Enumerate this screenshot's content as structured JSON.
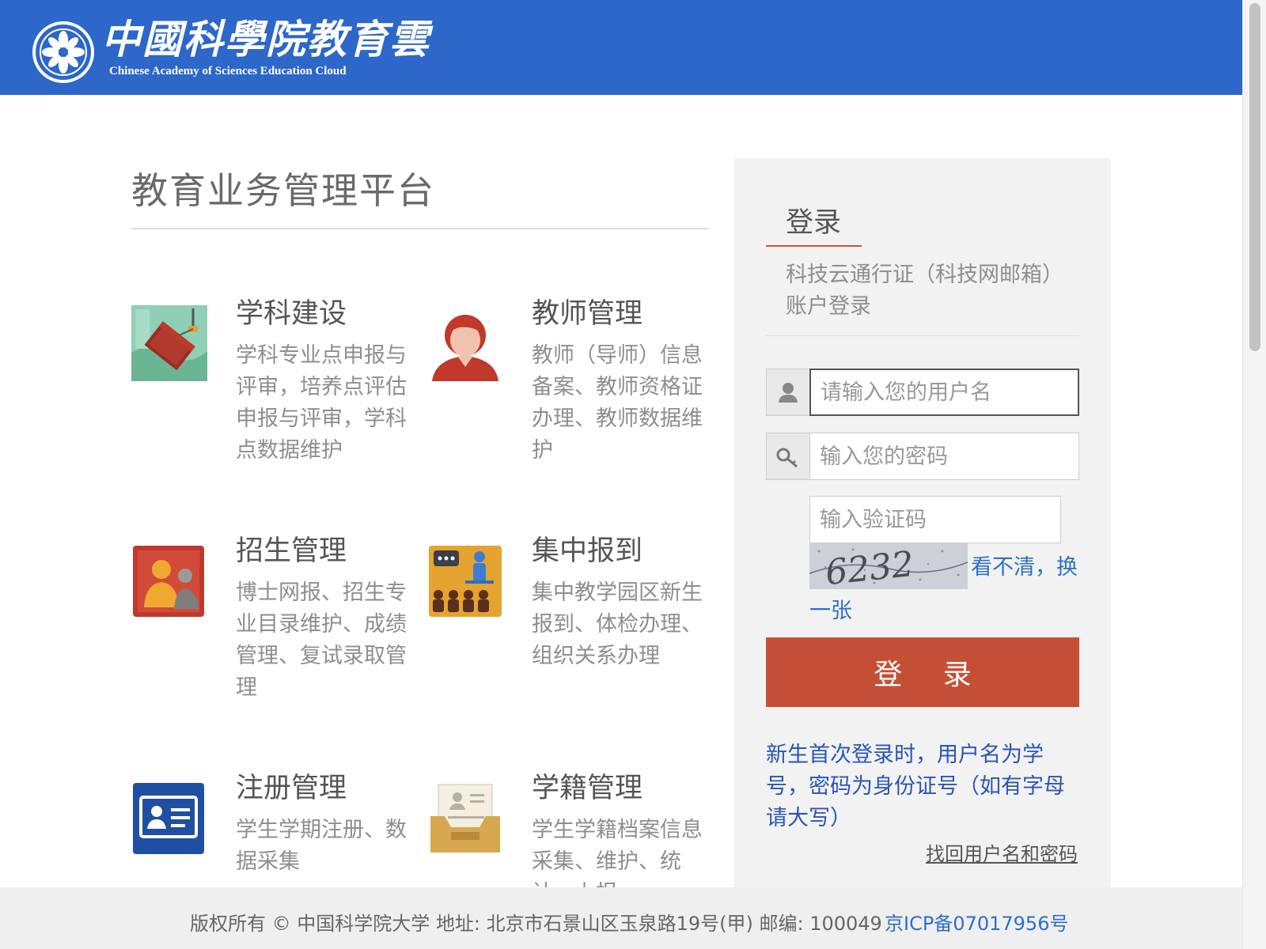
{
  "header": {
    "logo_cn": "中國科學院教育雲",
    "logo_en": "Chinese Academy of Sciences Education Cloud",
    "logo_icon": "cas-emblem-icon",
    "bg_color": "#2c67c9"
  },
  "main": {
    "title": "教育业务管理平台",
    "modules": [
      {
        "title": "学科建设",
        "desc": "学科专业点申报与评审，培养点评估申报与评审，学科点数据维护",
        "icon": "book-crane-icon"
      },
      {
        "title": "教师管理",
        "desc": "教师（导师）信息备案、教师资格证办理、教师数据维护",
        "icon": "teacher-avatar-icon"
      },
      {
        "title": "招生管理",
        "desc": "博士网报、招生专业目录维护、成绩管理、复试录取管理",
        "icon": "admission-people-icon"
      },
      {
        "title": "集中报到",
        "desc": "集中教学园区新生报到、体检办理、组织关系办理",
        "icon": "classroom-icon"
      },
      {
        "title": "注册管理",
        "desc": "学生学期注册、数据采集",
        "icon": "id-card-icon"
      },
      {
        "title": "学籍管理",
        "desc": "学生学籍档案信息采集、维护、统计、上报",
        "icon": "archive-tray-icon"
      }
    ]
  },
  "login": {
    "title": "登录",
    "subtitle": "科技云通行证（科技网邮箱）账户登录",
    "username_placeholder": "请输入您的用户名",
    "password_placeholder": "输入您的密码",
    "captcha_placeholder": "输入验证码",
    "captcha_text": "6232",
    "refresh_captcha_part1": "看不清，换",
    "refresh_captcha_part2": "一张",
    "submit_label": "登 录",
    "notice": "新生首次登录时，用户名为学号，密码为身份证号（如有字母请大写）",
    "recover_link": "找回用户名和密码",
    "accent_color": "#c54f35",
    "link_color": "#2e70c6"
  },
  "footer": {
    "copyright": "版权所有 © 中国科学院大学 地址: 北京市石景山区玉泉路19号(甲) 邮编: 100049",
    "icp": "京ICP备07017956号"
  }
}
